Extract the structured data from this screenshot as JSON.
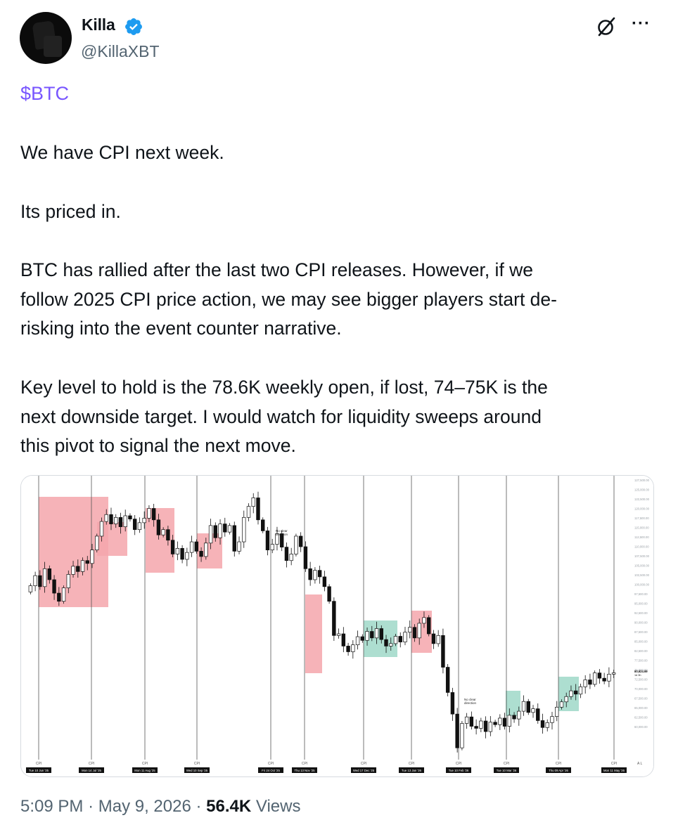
{
  "author": {
    "name": "Killa",
    "handle": "@KillaXBT",
    "verified": true,
    "avatar_icon": "avatar-image"
  },
  "tweet": {
    "cashtag": "$BTC",
    "paragraphs": [
      [
        "We have CPI next week."
      ],
      [
        "Its priced in."
      ],
      [
        "BTC has rallied after the last two CPI releases. However,  if we",
        "follow 2025 CPI price action, we may see bigger players start de-",
        "risking into the event counter narrative."
      ],
      [
        "Key level to hold is the 78.6K weekly open, if lost, 74–75K is the",
        "next downside target. I would watch for liquidity sweeps around",
        "this pivot to signal the next move."
      ]
    ]
  },
  "meta": {
    "time": "5:09 PM",
    "date": "May 9, 2026",
    "views_count": "56.4K",
    "views_label": "Views"
  },
  "icons": {
    "grok": "grok-icon",
    "more": "more-options-icon",
    "verified": "verified-badge-icon"
  },
  "colors": {
    "cashtag": "#7856ff",
    "verified": "#1d9bf0",
    "red_zone": "#f4a6ac",
    "green_zone": "#9fd8c8"
  },
  "chart_data": {
    "type": "candlestick",
    "event_label": "CPI",
    "cpi_dates": [
      "Tue 10 Jun '25",
      "Mon 14 Jul '25",
      "Mon 11 Aug '25",
      "Wed 10 Sep '25",
      "Fri 24 Oct '25",
      "Thu 13 Nov '25",
      "Wed 17 Dec '25",
      "Tue 13 Jan '26",
      "Tue 10 Feb '26",
      "Tue 10 Mar '26",
      "Thu 09 Apr '26",
      "Mon 11 May '26"
    ],
    "annotations": [
      {
        "text": [
          "No clear",
          "direction"
        ],
        "near": "Fri 24 Oct '25"
      },
      {
        "text": [
          "No clear",
          "direction"
        ],
        "near": "Tue 10 Feb '26"
      }
    ],
    "zones": [
      {
        "after": "Tue 10 Jun '25",
        "direction": "down",
        "color": "red"
      },
      {
        "after": "Mon 14 Jul '25",
        "direction": "down",
        "color": "red"
      },
      {
        "after": "Mon 11 Aug '25",
        "direction": "down",
        "color": "red"
      },
      {
        "after": "Wed 10 Sep '25",
        "direction": "down",
        "color": "red"
      },
      {
        "after": "Thu 13 Nov '25",
        "direction": "down",
        "color": "red"
      },
      {
        "after": "Wed 17 Dec '25",
        "direction": "up",
        "color": "green"
      },
      {
        "after": "Tue 13 Jan '26",
        "direction": "down",
        "color": "red"
      },
      {
        "after": "Tue 10 Mar '26",
        "direction": "up",
        "color": "green"
      },
      {
        "after": "Thu 09 Apr '26",
        "direction": "up",
        "color": "green"
      }
    ],
    "y_axis_labels": [
      "127,500.00",
      "125,000.00",
      "122,500.00",
      "120,000.00",
      "117,500.00",
      "115,000.00",
      "112,500.00",
      "110,000.00",
      "107,500.00",
      "105,000.00",
      "102,500.00",
      "100,000.00",
      "97,500.00",
      "95,000.00",
      "92,500.00",
      "90,000.00",
      "87,500.00",
      "85,000.00",
      "82,500.00",
      "77,500.00",
      "75,000.00",
      "72,500.00",
      "70,000.00",
      "67,500.00",
      "65,000.00",
      "62,500.00",
      "60,000.00"
    ],
    "ylim": [
      60000,
      128000
    ],
    "last_price_label": "80,624.69",
    "last_price_sub": "1d 3h",
    "closes": [
      102000,
      104500,
      101800,
      106200,
      103500,
      100200,
      98200,
      101500,
      104800,
      106800,
      105500,
      108200,
      107500,
      110800,
      114200,
      117800,
      119500,
      117200,
      118800,
      116500,
      119200,
      118400,
      115800,
      117500,
      118600,
      121000,
      118200,
      114500,
      115800,
      113200,
      109800,
      111200,
      108500,
      110200,
      112800,
      110500,
      109200,
      112500,
      116800,
      113800,
      117200,
      115200,
      116800,
      110500,
      112800,
      118800,
      121500,
      123600,
      118200,
      115500,
      110800,
      112200,
      114800,
      111500,
      108200,
      109800,
      114200,
      111600,
      106200,
      103500,
      105800,
      104200,
      101800,
      98200,
      89800,
      90200,
      87200,
      85800,
      87500,
      89500,
      88600,
      90800,
      89200,
      91500,
      88800,
      87200,
      87800,
      89600,
      88200,
      90600,
      91800,
      89200,
      92800,
      94200,
      90200,
      87800,
      89800,
      82000,
      75800,
      70500,
      62200,
      68200,
      69800,
      67500,
      67000,
      68800,
      66200,
      68500,
      67900,
      69500,
      67500,
      70200,
      69300,
      71200,
      73600,
      70900,
      71800,
      68900,
      67200,
      68400,
      69900,
      72200,
      73500,
      74800,
      76200,
      75400,
      77200,
      78900,
      77800,
      80600,
      79300,
      78600,
      80300,
      80624
    ]
  }
}
